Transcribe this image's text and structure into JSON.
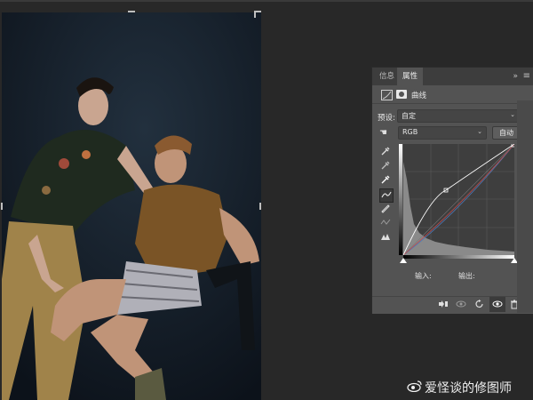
{
  "panel": {
    "tabs": [
      {
        "label": "信息"
      },
      {
        "label": "属性"
      }
    ],
    "collapse_icon": "double-chevron-right-icon",
    "menu_icon": "panel-menu-icon",
    "title": "曲线",
    "preset_label": "预设:",
    "preset_value": "自定",
    "channel_value": "RGB",
    "auto_label": "自动",
    "input_label": "输入:",
    "output_label": "输出:",
    "tools": [
      "target-adjust-icon",
      "black-eyedropper-icon",
      "gray-eyedropper-icon",
      "white-eyedropper-icon",
      "curve-edit-icon",
      "pencil-icon",
      "smooth-icon",
      "clipping-warning-icon"
    ],
    "footer_icons": [
      "clip-to-layer-icon",
      "view-previous-icon",
      "reset-icon",
      "visibility-eye-icon",
      "trash-icon"
    ]
  },
  "watermark": {
    "text": "爱怪谈的修图师"
  },
  "colors": {
    "panel_bg": "#535353",
    "workspace_bg": "#282828",
    "curve_white": "#ffffff",
    "curve_blue": "#4a7ab8",
    "curve_red": "#c04a4a"
  }
}
